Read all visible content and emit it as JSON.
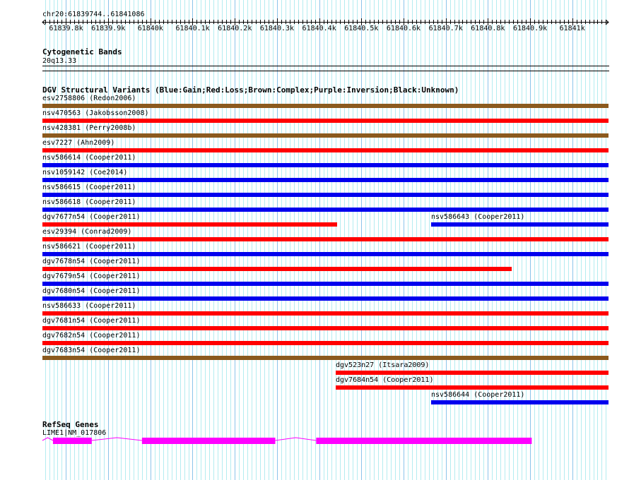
{
  "ruler": {
    "region_label": "chr20:61839744..61841086",
    "start": 61839744,
    "end": 61841086,
    "tick_labels": [
      "61839.8k",
      "61839.9k",
      "61840k",
      "61840.1k",
      "61840.2k",
      "61840.3k",
      "61840.4k",
      "61840.5k",
      "61840.6k",
      "61840.7k",
      "61840.8k",
      "61840.9k",
      "61841k"
    ]
  },
  "cytoband": {
    "title": "Cytogenetic Bands",
    "band": "20q13.33"
  },
  "dgv": {
    "title": "DGV Structural Variants (Blue:Gain;Red:Loss;Brown:Complex;Purple:Inversion;Black:Unknown)",
    "colors": {
      "gain": "#0000ee",
      "loss": "#ff0000",
      "complex": "#8b5a1e",
      "inversion": "#a020f0",
      "unknown": "#000000"
    },
    "rows": [
      [
        {
          "label": "esv2758806 (Redon2006)",
          "type": "complex",
          "start": 61839744,
          "end": 61841086
        }
      ],
      [
        {
          "label": "nsv470563 (Jakobsson2008)",
          "type": "loss",
          "start": 61839744,
          "end": 61841086
        }
      ],
      [
        {
          "label": "nsv428381 (Perry2008b)",
          "type": "complex",
          "start": 61839744,
          "end": 61841086
        }
      ],
      [
        {
          "label": "esv7227 (Ahn2009)",
          "type": "loss",
          "start": 61839744,
          "end": 61841086
        }
      ],
      [
        {
          "label": "nsv586614 (Cooper2011)",
          "type": "gain",
          "start": 61839744,
          "end": 61841086
        }
      ],
      [
        {
          "label": "nsv1059142 (Coe2014)",
          "type": "gain",
          "start": 61839744,
          "end": 61841086
        }
      ],
      [
        {
          "label": "nsv586615 (Cooper2011)",
          "type": "gain",
          "start": 61839744,
          "end": 61841086
        }
      ],
      [
        {
          "label": "nsv586618 (Cooper2011)",
          "type": "gain",
          "start": 61839744,
          "end": 61841086
        }
      ],
      [
        {
          "label": "dgv7677n54 (Cooper2011)",
          "type": "loss",
          "start": 61839744,
          "end": 61840442
        },
        {
          "label": "nsv586643 (Cooper2011)",
          "type": "gain",
          "start": 61840666,
          "end": 61841086
        }
      ],
      [
        {
          "label": "esv29394 (Conrad2009)",
          "type": "loss",
          "start": 61839744,
          "end": 61841086
        }
      ],
      [
        {
          "label": "nsv586621 (Cooper2011)",
          "type": "gain",
          "start": 61839744,
          "end": 61841086
        }
      ],
      [
        {
          "label": "dgv7678n54 (Cooper2011)",
          "type": "loss",
          "start": 61839744,
          "end": 61840857
        }
      ],
      [
        {
          "label": "dgv7679n54 (Cooper2011)",
          "type": "gain",
          "start": 61839744,
          "end": 61841086
        }
      ],
      [
        {
          "label": "dgv7680n54 (Cooper2011)",
          "type": "gain",
          "start": 61839744,
          "end": 61841086
        }
      ],
      [
        {
          "label": "nsv586633 (Cooper2011)",
          "type": "loss",
          "start": 61839744,
          "end": 61841086
        }
      ],
      [
        {
          "label": "dgv7681n54 (Cooper2011)",
          "type": "loss",
          "start": 61839744,
          "end": 61841086
        }
      ],
      [
        {
          "label": "dgv7682n54 (Cooper2011)",
          "type": "loss",
          "start": 61839744,
          "end": 61841086
        }
      ],
      [
        {
          "label": "dgv7683n54 (Cooper2011)",
          "type": "complex",
          "start": 61839744,
          "end": 61841086
        }
      ],
      [
        {
          "label": "dgv523n27 (Itsara2009)",
          "type": "loss",
          "start": 61840439,
          "end": 61841086
        }
      ],
      [
        {
          "label": "dgv7684n54 (Cooper2011)",
          "type": "loss",
          "start": 61840439,
          "end": 61841086
        }
      ],
      [
        {
          "label": "nsv586644 (Cooper2011)",
          "type": "gain",
          "start": 61840666,
          "end": 61841086
        }
      ]
    ]
  },
  "refseq": {
    "title": "RefSeq Genes",
    "gene_label": "LIME1|NM_017806",
    "color": "#ff00ff",
    "exons": [
      [
        61839769,
        61839861
      ],
      [
        61839980,
        61840296
      ],
      [
        61840393,
        61840904
      ]
    ]
  }
}
